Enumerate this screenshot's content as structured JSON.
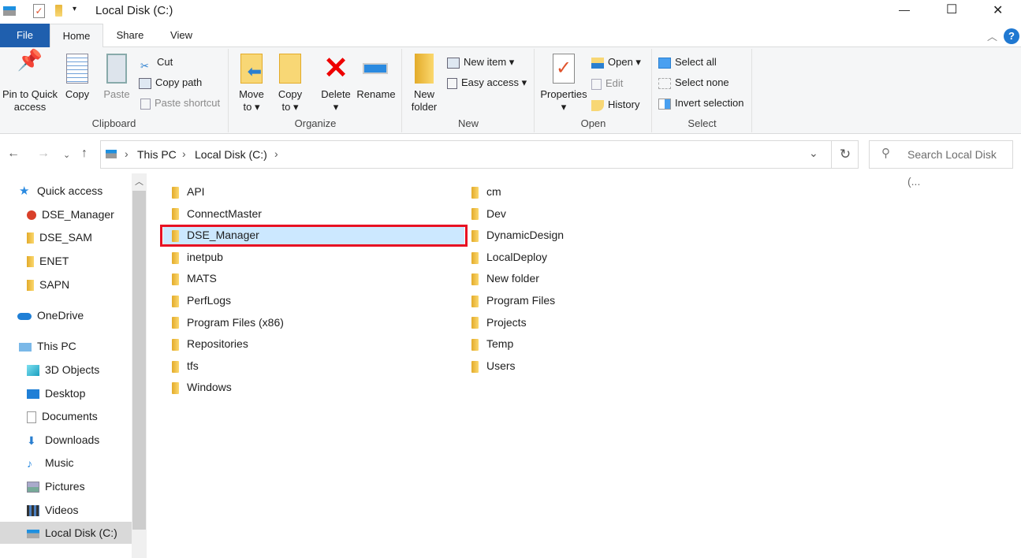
{
  "window": {
    "title": "Local Disk (C:)",
    "minimize": "—",
    "maximize": "☐",
    "close": "✕"
  },
  "tabs": [
    {
      "label": "File"
    },
    {
      "label": "Home"
    },
    {
      "label": "Share"
    },
    {
      "label": "View"
    }
  ],
  "ribbon": {
    "clipboard": {
      "label": "Clipboard",
      "pin": "Pin to Quick",
      "pin2": "access",
      "copy": "Copy",
      "paste": "Paste",
      "cut": "Cut",
      "copy_path": "Copy path",
      "paste_shortcut": "Paste shortcut"
    },
    "organize": {
      "label": "Organize",
      "move": "Move",
      "move2": "to ▾",
      "copyto": "Copy",
      "copyto2": "to ▾",
      "delete": "Delete",
      "delete2": "▾",
      "rename": "Rename"
    },
    "new": {
      "label": "New",
      "new_folder": "New",
      "new_folder2": "folder",
      "new_item": "New item ▾",
      "easy_access": "Easy access ▾"
    },
    "open": {
      "label": "Open",
      "properties": "Properties",
      "properties2": "▾",
      "open": "Open ▾",
      "edit": "Edit",
      "history": "History"
    },
    "select": {
      "label": "Select",
      "select_all": "Select all",
      "select_none": "Select none",
      "invert": "Invert selection"
    }
  },
  "address": {
    "crumbs": [
      "This PC",
      "Local Disk (C:)"
    ],
    "search_placeholder": "Search Local Disk (..."
  },
  "sidebar": {
    "items": [
      {
        "label": "Quick access",
        "icon": "star-icon"
      },
      {
        "label": "DSE_Manager",
        "icon": "folder-warning-icon"
      },
      {
        "label": "DSE_SAM",
        "icon": "folder-icon"
      },
      {
        "label": "ENET",
        "icon": "folder-icon"
      },
      {
        "label": "SAPN",
        "icon": "folder-icon"
      },
      {
        "label": "OneDrive",
        "icon": "cloud-icon"
      },
      {
        "label": "This PC",
        "icon": "computer-icon"
      },
      {
        "label": "3D Objects",
        "icon": "cube-icon"
      },
      {
        "label": "Desktop",
        "icon": "desktop-icon"
      },
      {
        "label": "Documents",
        "icon": "document-icon"
      },
      {
        "label": "Downloads",
        "icon": "download-icon"
      },
      {
        "label": "Music",
        "icon": "music-icon"
      },
      {
        "label": "Pictures",
        "icon": "picture-icon"
      },
      {
        "label": "Videos",
        "icon": "video-icon"
      },
      {
        "label": "Local Disk (C:)",
        "icon": "drive-icon"
      }
    ]
  },
  "files": {
    "col1": [
      "API",
      "ConnectMaster",
      "DSE_Manager",
      "inetpub",
      "MATS",
      "PerfLogs",
      "Program Files (x86)",
      "Repositories",
      "tfs",
      "Windows"
    ],
    "col2": [
      "cm",
      "Dev",
      "DynamicDesign",
      "LocalDeploy",
      "New folder",
      "Program Files",
      "Projects",
      "Temp",
      "Users"
    ],
    "selected": "DSE_Manager"
  },
  "colors": {
    "file_tab": "#1f5fae",
    "selection": "#cce8ff",
    "highlight_box": "#e81123"
  }
}
